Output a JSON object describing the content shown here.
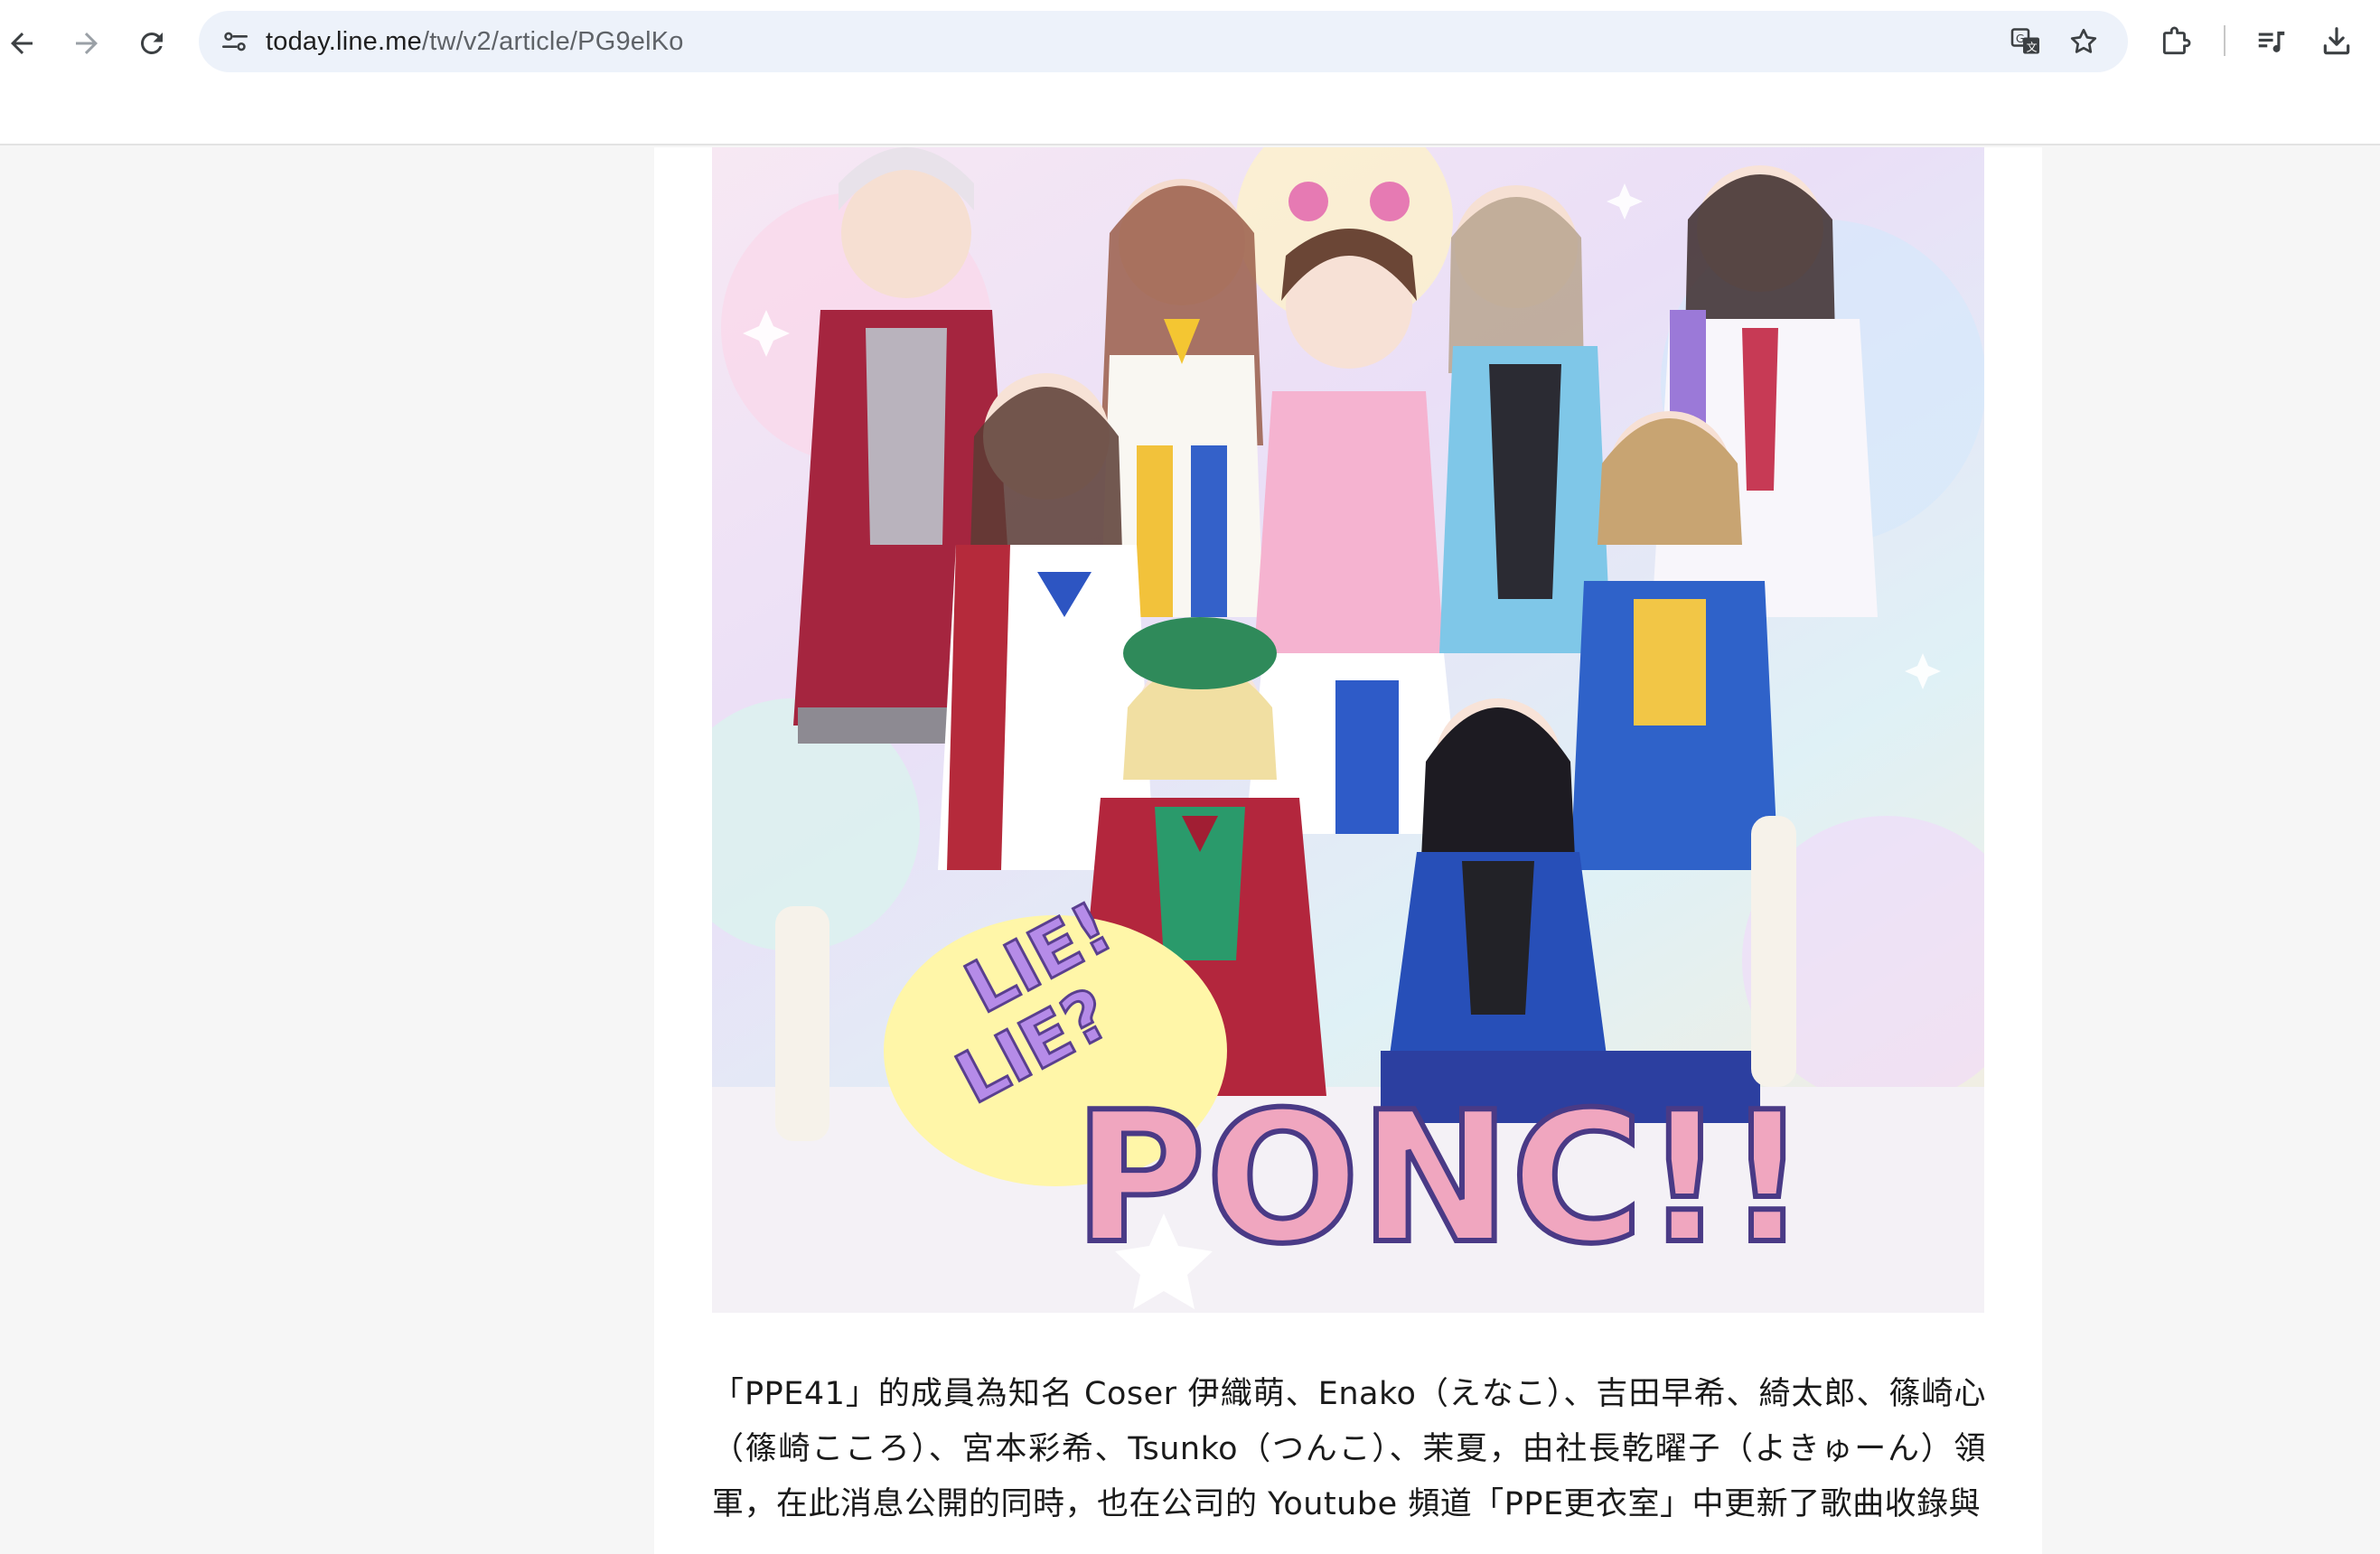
{
  "browser": {
    "url_host": "today.line.me",
    "url_path": "/tw/v2/article/PG9elKo",
    "icons": {
      "back": "arrow-left-icon",
      "forward": "arrow-right-icon",
      "reload": "reload-icon",
      "site_info": "tune-icon",
      "translate": "translate-icon",
      "bookmark": "star-icon",
      "extensions": "puzzle-icon",
      "reading_list": "media-queue-icon",
      "downloads": "download-icon"
    }
  },
  "article": {
    "photo": {
      "logo_text_top": "LIE!",
      "logo_text_bottom": "LIE?",
      "logo_main": "PONC!!"
    },
    "paragraph": "「PPE41」的成員為知名 Coser 伊織萌、Enako（えなこ）、吉田早希、綺太郎、篠崎心（篠崎こころ）、宮本彩希、Tsunko（つんこ）、茉夏，由社長乾曜子（よきゅーん）領軍，在此消息公開的同時，也在公司的 Youtube 頻道「PPE更衣室」中更新了歌曲收錄與"
  },
  "colors": {
    "page_background": "#f6f6f6",
    "omnibox": "#edf2fa",
    "text": "#1a1a1a"
  }
}
